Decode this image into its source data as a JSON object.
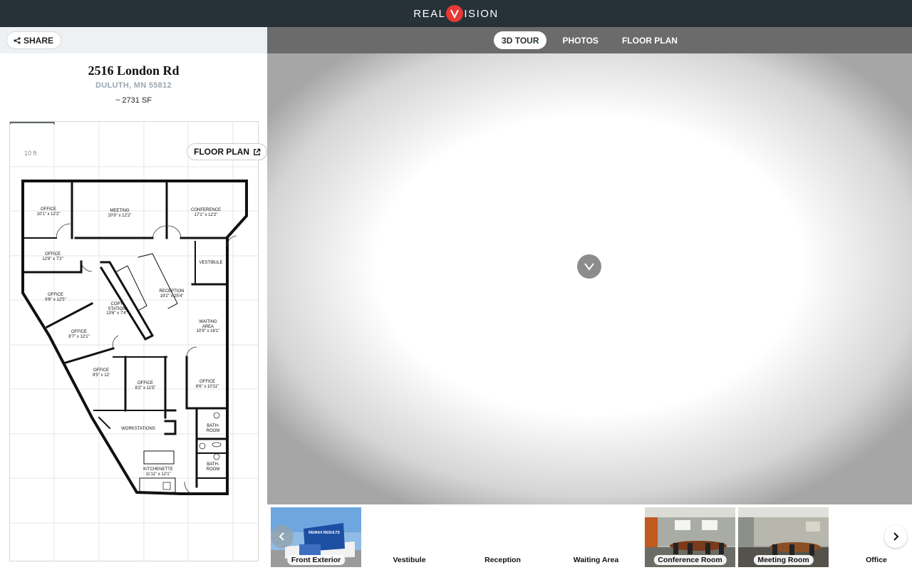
{
  "brand": {
    "left": "REAL",
    "right": "ISION",
    "v": "V"
  },
  "share": {
    "label": "SHARE"
  },
  "property": {
    "address": "2516 London Rd",
    "city": "DULUTH, MN 55812",
    "size": "~ 2731 SF"
  },
  "floorplan": {
    "button_label": "FLOOR PLAN",
    "scale_label": "10 ft",
    "rooms": [
      {
        "name": "OFFICE",
        "dims": "10'1\" x 12'2\""
      },
      {
        "name": "MEETING",
        "dims": "20'9\" x 12'2\""
      },
      {
        "name": "CONFERENCE",
        "dims": "17'1\" x 12'2\""
      },
      {
        "name": "OFFICE",
        "dims": "12'8\" x 7'2\""
      },
      {
        "name": "VESTIBULE",
        "dims": ""
      },
      {
        "name": "OFFICE",
        "dims": "9'6\" x 12'5\""
      },
      {
        "name": "COPY",
        "dims": ""
      },
      {
        "name": "STATION",
        "dims": "13'6\" x 7'4\""
      },
      {
        "name": "RECEPTION",
        "dims": "19'2\" x 25'4\""
      },
      {
        "name": "WAITING",
        "dims": ""
      },
      {
        "name": "AREA",
        "dims": "10'9\" x 16'1\""
      },
      {
        "name": "OFFICE",
        "dims": "8'7\" x 12'1\""
      },
      {
        "name": "OFFICE",
        "dims": "9'5\" x 12'"
      },
      {
        "name": "OFFICE",
        "dims": "8'2\" x 11'5\""
      },
      {
        "name": "OFFICE",
        "dims": "8'6\" x 10'11\""
      },
      {
        "name": "WORKSTATIONS",
        "dims": ""
      },
      {
        "name": "BATH-",
        "dims": ""
      },
      {
        "name": "ROOM",
        "dims": ""
      },
      {
        "name": "BATH-",
        "dims": ""
      },
      {
        "name": "ROOM",
        "dims": ""
      },
      {
        "name": "KITCHENETTE",
        "dims": "11'11\" x 12'1\""
      }
    ]
  },
  "tabs": [
    {
      "label": "3D TOUR",
      "active": true
    },
    {
      "label": "PHOTOS",
      "active": false
    },
    {
      "label": "FLOOR PLAN",
      "active": false
    }
  ],
  "thumbnails": [
    {
      "label": "Front Exterior",
      "has_photo": true,
      "sign": "RE/MAX RESULTS"
    },
    {
      "label": "Vestibule",
      "has_photo": false
    },
    {
      "label": "Reception",
      "has_photo": false
    },
    {
      "label": "Waiting Area",
      "has_photo": false
    },
    {
      "label": "Conference Room",
      "has_photo": true
    },
    {
      "label": "Meeting Room",
      "has_photo": true
    },
    {
      "label": "Office",
      "has_photo": false
    }
  ],
  "colors": {
    "topbar": "#263238",
    "accent": "#e53935",
    "tabbar": "#6b6b6b",
    "city": "#9aa7b2"
  }
}
